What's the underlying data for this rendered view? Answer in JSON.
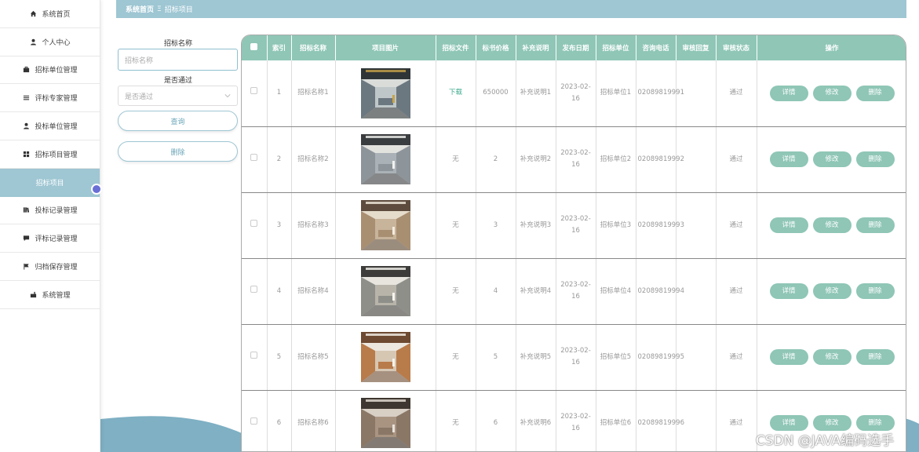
{
  "sidebar": {
    "items": [
      {
        "label": "系统首页",
        "icon": "home-icon"
      },
      {
        "label": "个人中心",
        "icon": "user-icon"
      },
      {
        "label": "招标单位管理",
        "icon": "briefcase-icon"
      },
      {
        "label": "评标专家管理",
        "icon": "list-icon"
      },
      {
        "label": "投标单位管理",
        "icon": "user-icon"
      },
      {
        "label": "招标项目管理",
        "icon": "grid-icon"
      },
      {
        "label": "招标项目",
        "icon": "",
        "active": true
      },
      {
        "label": "投标记录管理",
        "icon": "book-icon"
      },
      {
        "label": "评标记录管理",
        "icon": "comment-icon"
      },
      {
        "label": "归档保存管理",
        "icon": "flag-icon"
      },
      {
        "label": "系统管理",
        "icon": "settings-icon"
      }
    ]
  },
  "breadcrumb": {
    "home": "系统首页",
    "separator": "Ξ",
    "current": "招标项目"
  },
  "search": {
    "name_label": "招标名称",
    "name_placeholder": "招标名称",
    "pass_label": "是否通过",
    "pass_placeholder": "是否通过",
    "query_button": "查询",
    "delete_button": "删除"
  },
  "table": {
    "headers": [
      "",
      "索引",
      "招标名称",
      "项目图片",
      "招标文件",
      "标书价格",
      "补充说明",
      "发布日期",
      "招标单位",
      "咨询电话",
      "审核回复",
      "审核状态",
      "操作"
    ],
    "rows": [
      {
        "index": "1",
        "name": "招标名称1",
        "file": "下载",
        "file_link": true,
        "price": "650000",
        "note": "补充说明1",
        "date": "2023-02-16",
        "unit": "招标单位1",
        "phone": "02089819991",
        "reply": "",
        "status": "通过",
        "image": "office-open"
      },
      {
        "index": "2",
        "name": "招标名称2",
        "file": "无",
        "file_link": false,
        "price": "2",
        "note": "补充说明2",
        "date": "2023-02-16",
        "unit": "招标单位2",
        "phone": "02089819992",
        "reply": "",
        "status": "通过",
        "image": "office-desks"
      },
      {
        "index": "3",
        "name": "招标名称3",
        "file": "无",
        "file_link": false,
        "price": "3",
        "note": "补充说明3",
        "date": "2023-02-16",
        "unit": "招标单位3",
        "phone": "02089819993",
        "reply": "",
        "status": "通过",
        "image": "lounge-warm"
      },
      {
        "index": "4",
        "name": "招标名称4",
        "file": "无",
        "file_link": false,
        "price": "4",
        "note": "补充说明4",
        "date": "2023-02-16",
        "unit": "招标单位4",
        "phone": "02089819994",
        "reply": "",
        "status": "通过",
        "image": "living-room"
      },
      {
        "index": "5",
        "name": "招标名称5",
        "file": "无",
        "file_link": false,
        "price": "5",
        "note": "补充说明5",
        "date": "2023-02-16",
        "unit": "招标单位5",
        "phone": "02089819995",
        "reply": "",
        "status": "通过",
        "image": "reception"
      },
      {
        "index": "6",
        "name": "招标名称6",
        "file": "无",
        "file_link": false,
        "price": "6",
        "note": "补充说明6",
        "date": "2023-02-16",
        "unit": "招标单位6",
        "phone": "02089819996",
        "reply": "",
        "status": "通过",
        "image": "stairs-loft"
      }
    ],
    "actions": {
      "detail": "详情",
      "edit": "修改",
      "delete": "删除"
    }
  },
  "watermark": "CSDN @JAVA编码选手",
  "colors": {
    "accent": "#9ec6d3",
    "table_header": "#8fc6b6",
    "link": "#3aa98c",
    "cursor_dot": "#6a6fd6"
  }
}
